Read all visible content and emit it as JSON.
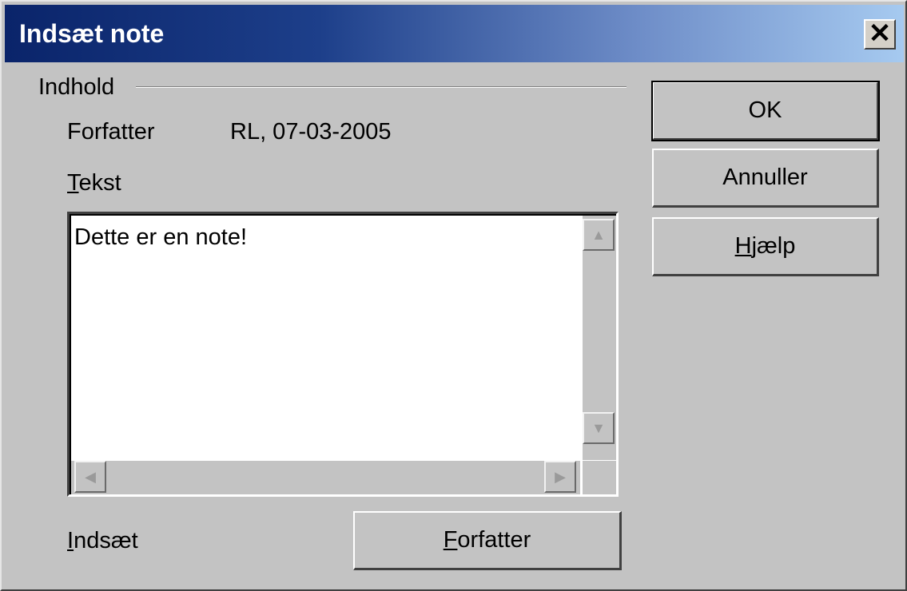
{
  "window": {
    "title": "Indsæt note",
    "close_glyph": "✕"
  },
  "content": {
    "group_label": "Indhold",
    "author_label": "Forfatter",
    "author_value": "RL, 07-03-2005",
    "text_label_mnemonic": "T",
    "text_label_rest": "ekst",
    "text_value": "Dette er en note!",
    "insert_label_mnemonic": "I",
    "insert_label_rest": "ndsæt",
    "author_button_mnemonic": "F",
    "author_button_rest": "orfatter"
  },
  "buttons": {
    "ok": "OK",
    "cancel": "Annuller",
    "help_mnemonic": "H",
    "help_rest": "jælp"
  },
  "scrollbar": {
    "up_glyph": "▲",
    "down_glyph": "▼",
    "left_glyph": "◀",
    "right_glyph": "▶"
  }
}
